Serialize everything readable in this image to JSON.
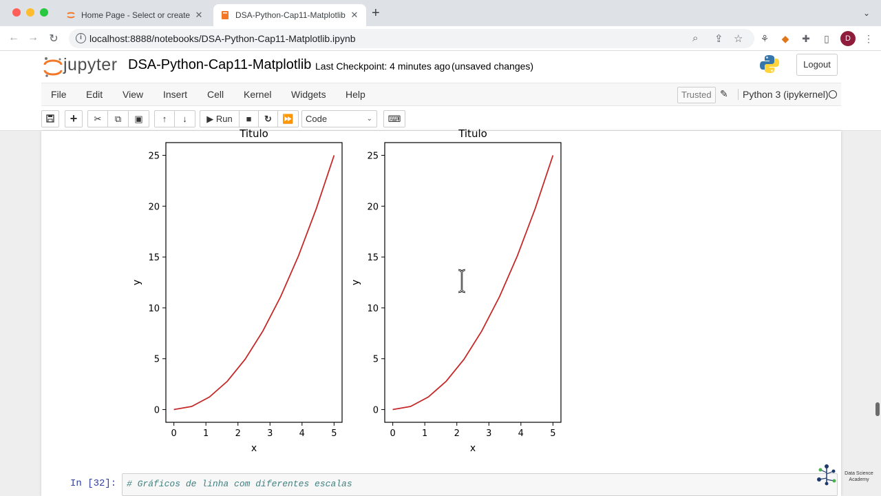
{
  "browser": {
    "tabs": [
      {
        "title": "Home Page - Select or create a",
        "close": "✕"
      },
      {
        "title": "DSA-Python-Cap11-Matplotlib",
        "close": "✕"
      }
    ],
    "new_tab": "+",
    "url": "localhost:8888/notebooks/DSA-Python-Cap11-Matplotlib.ipynb",
    "profile_initial": "D"
  },
  "jupyter": {
    "logo_text": "jupyter",
    "notebook_name": "DSA-Python-Cap11-Matplotlib",
    "checkpoint": "Last Checkpoint: 4 minutes ago",
    "unsaved": "(unsaved changes)",
    "logout": "Logout",
    "menu": [
      "File",
      "Edit",
      "View",
      "Insert",
      "Cell",
      "Kernel",
      "Widgets",
      "Help"
    ],
    "trusted": "Trusted",
    "kernel": "Python 3 (ipykernel)",
    "toolbar": {
      "run_label": "Run",
      "cell_type": "Code"
    }
  },
  "chart_data": [
    {
      "type": "line",
      "title": "Titulo",
      "xlabel": "x",
      "ylabel": "y",
      "x": [
        0,
        0.556,
        1.111,
        1.667,
        2.222,
        2.778,
        3.333,
        3.889,
        4.444,
        5.0
      ],
      "series": [
        {
          "values": [
            0,
            0.309,
            1.235,
            2.778,
            4.938,
            7.716,
            11.111,
            15.123,
            19.753,
            25.0
          ],
          "color": "#c62828"
        }
      ],
      "xticks": [
        "0",
        "1",
        "2",
        "3",
        "4",
        "5"
      ],
      "yticks": [
        "0",
        "5",
        "10",
        "15",
        "20",
        "25"
      ],
      "xlim": [
        -0.25,
        5.25
      ],
      "ylim": [
        -1.25,
        26.25
      ]
    },
    {
      "type": "line",
      "title": "Titulo",
      "xlabel": "x",
      "ylabel": "y",
      "x": [
        0,
        0.556,
        1.111,
        1.667,
        2.222,
        2.778,
        3.333,
        3.889,
        4.444,
        5.0
      ],
      "series": [
        {
          "values": [
            0,
            0.309,
            1.235,
            2.778,
            4.938,
            7.716,
            11.111,
            15.123,
            19.753,
            25.0
          ],
          "color": "#c62828"
        }
      ],
      "xticks": [
        "0",
        "1",
        "2",
        "3",
        "4",
        "5"
      ],
      "yticks": [
        "0",
        "5",
        "10",
        "15",
        "20",
        "25"
      ],
      "xlim": [
        -0.25,
        5.25
      ],
      "ylim": [
        -1.25,
        26.25
      ]
    }
  ],
  "cell": {
    "prompt": "In [32]:",
    "code": "# Gráficos de linha com diferentes escalas"
  },
  "watermark": {
    "line1": "Data Science",
    "line2": "Academy"
  }
}
